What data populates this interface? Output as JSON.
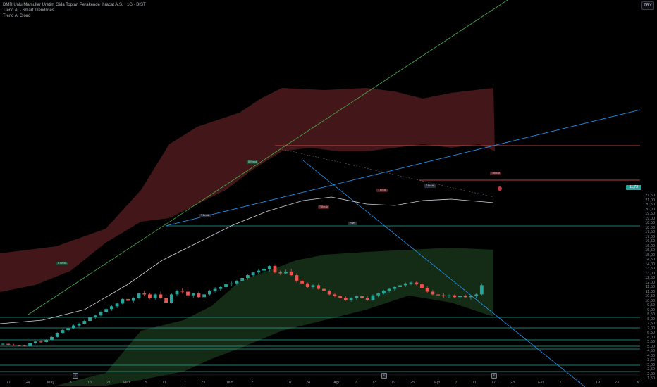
{
  "legend": {
    "symbol_line": "DMR Unlu Mamuller Uretim Gida Toptan Perakende Ihracat A.S. · 1G · BIST",
    "indicator_1": "Trend Ai - Smart Trendlines",
    "indicator_2": "Trend Ai Cloud"
  },
  "currency": "TRY",
  "last_price": "11,73",
  "price_axis": [
    "21,50",
    "21,00",
    "20,50",
    "20,00",
    "19,50",
    "19,00",
    "18,50",
    "18,00",
    "17,50",
    "17,00",
    "16,50",
    "16,00",
    "15,50",
    "15,00",
    "14,50",
    "14,00",
    "13,50",
    "13,00",
    "12,50",
    "12,00",
    "11,50",
    "11,00",
    "10,50",
    "10,00",
    "9,50",
    "9,00",
    "8,50",
    "8,00",
    "7,50",
    "7,00",
    "6,50",
    "6,00",
    "5,50",
    "5,00",
    "4,50",
    "4,00",
    "3,50",
    "3,00",
    "2,50",
    "2,00",
    "1,50"
  ],
  "time_axis": [
    "17",
    "24",
    "May",
    "8",
    "15",
    "21",
    "Haz",
    "5",
    "11",
    "17",
    "23",
    "Tem",
    "12",
    "18",
    "24",
    "Ağu",
    "7",
    "13",
    "19",
    "25",
    "Eyl",
    "7",
    "11",
    "17",
    "23",
    "Eki",
    "7",
    "13",
    "19",
    "23",
    "K"
  ],
  "event_markers": [
    "E",
    "E",
    "F"
  ],
  "annotations": [
    "B Break",
    "B Break",
    "T Break",
    "T Break",
    "T Break",
    "T Break",
    "Pdev",
    "T Break"
  ],
  "colors": {
    "up": "#26a69a",
    "down": "#ef5350",
    "cloud_top": "#4a1a1c",
    "cloud_bottom": "#163018",
    "trend_green": "#4caf50",
    "trend_blue": "#2196f3",
    "level_red": "#ef5350",
    "level_green": "#26a69a",
    "ma": "#d1d4dc"
  },
  "chart_data": {
    "type": "candlestick",
    "ylim": [
      1.5,
      21.5
    ],
    "candles": [
      [
        5.3,
        5.35,
        5.25,
        5.3
      ],
      [
        5.3,
        5.35,
        5.2,
        5.2
      ],
      [
        5.2,
        5.3,
        5.1,
        5.15
      ],
      [
        5.15,
        5.2,
        5.05,
        5.1
      ],
      [
        5.1,
        5.2,
        5.0,
        5.05
      ],
      [
        5.05,
        5.4,
        5.0,
        5.35
      ],
      [
        5.35,
        5.6,
        5.3,
        5.55
      ],
      [
        5.55,
        5.7,
        5.4,
        5.5
      ],
      [
        5.5,
        5.8,
        5.45,
        5.75
      ],
      [
        5.75,
        6.1,
        5.7,
        6.05
      ],
      [
        6.05,
        6.6,
        6.0,
        6.5
      ],
      [
        6.5,
        6.9,
        6.4,
        6.8
      ],
      [
        6.8,
        7.1,
        6.6,
        7.0
      ],
      [
        7.0,
        7.4,
        6.9,
        7.3
      ],
      [
        7.3,
        7.6,
        7.1,
        7.5
      ],
      [
        7.5,
        7.9,
        7.4,
        7.8
      ],
      [
        7.8,
        8.3,
        7.7,
        8.2
      ],
      [
        8.2,
        8.5,
        8.0,
        8.4
      ],
      [
        8.4,
        8.9,
        8.3,
        8.8
      ],
      [
        8.8,
        9.2,
        8.6,
        9.1
      ],
      [
        9.1,
        9.5,
        8.9,
        9.4
      ],
      [
        9.4,
        9.8,
        9.2,
        9.7
      ],
      [
        9.7,
        10.3,
        9.6,
        10.2
      ],
      [
        10.2,
        10.6,
        9.9,
        10.0
      ],
      [
        10.0,
        10.4,
        9.8,
        10.3
      ],
      [
        10.3,
        10.9,
        10.2,
        10.8
      ],
      [
        10.8,
        11.1,
        10.5,
        10.7
      ],
      [
        10.7,
        10.9,
        10.2,
        10.3
      ],
      [
        10.3,
        10.8,
        10.1,
        10.7
      ],
      [
        10.7,
        11.0,
        10.2,
        10.3
      ],
      [
        10.3,
        10.5,
        9.7,
        9.8
      ],
      [
        9.8,
        10.8,
        9.7,
        10.7
      ],
      [
        10.7,
        11.2,
        10.5,
        11.1
      ],
      [
        11.1,
        11.4,
        10.8,
        11.0
      ],
      [
        11.0,
        11.1,
        10.5,
        10.6
      ],
      [
        10.6,
        10.9,
        10.3,
        10.8
      ],
      [
        10.8,
        11.0,
        10.3,
        10.4
      ],
      [
        10.4,
        10.8,
        10.2,
        10.7
      ],
      [
        10.7,
        11.2,
        10.6,
        11.1
      ],
      [
        11.1,
        11.5,
        10.9,
        11.3
      ],
      [
        11.3,
        11.6,
        11.1,
        11.5
      ],
      [
        11.5,
        11.9,
        11.3,
        11.8
      ],
      [
        11.8,
        12.1,
        11.6,
        11.9
      ],
      [
        11.9,
        12.3,
        11.7,
        12.2
      ],
      [
        12.2,
        12.6,
        12.0,
        12.5
      ],
      [
        12.5,
        12.9,
        12.3,
        12.8
      ],
      [
        12.8,
        13.2,
        12.6,
        13.1
      ],
      [
        13.1,
        13.5,
        12.9,
        13.3
      ],
      [
        13.3,
        13.7,
        13.0,
        13.5
      ],
      [
        13.5,
        13.9,
        13.2,
        13.8
      ],
      [
        13.8,
        14.0,
        13.0,
        13.1
      ],
      [
        13.1,
        13.3,
        12.8,
        13.0
      ],
      [
        13.0,
        13.4,
        12.9,
        13.2
      ],
      [
        13.2,
        13.5,
        12.7,
        12.8
      ],
      [
        12.8,
        13.0,
        12.0,
        12.2
      ],
      [
        12.2,
        12.5,
        11.8,
        11.9
      ],
      [
        11.9,
        12.0,
        11.4,
        11.5
      ],
      [
        11.5,
        11.8,
        11.3,
        11.7
      ],
      [
        11.7,
        11.9,
        11.2,
        11.3
      ],
      [
        11.3,
        11.6,
        11.0,
        11.1
      ],
      [
        11.1,
        11.2,
        10.6,
        10.7
      ],
      [
        10.7,
        10.9,
        10.4,
        10.5
      ],
      [
        10.5,
        10.7,
        10.2,
        10.3
      ],
      [
        10.3,
        10.5,
        10.0,
        10.1
      ],
      [
        10.1,
        10.4,
        9.9,
        10.3
      ],
      [
        10.3,
        10.6,
        10.1,
        10.5
      ],
      [
        10.5,
        10.7,
        10.2,
        10.3
      ],
      [
        10.3,
        10.5,
        10.0,
        10.1
      ],
      [
        10.1,
        10.7,
        10.0,
        10.6
      ],
      [
        10.6,
        10.9,
        10.4,
        10.8
      ],
      [
        10.8,
        11.2,
        10.7,
        11.1
      ],
      [
        11.1,
        11.4,
        10.9,
        11.3
      ],
      [
        11.3,
        11.6,
        11.1,
        11.5
      ],
      [
        11.5,
        11.8,
        11.3,
        11.7
      ],
      [
        11.7,
        12.0,
        11.5,
        11.9
      ],
      [
        11.9,
        12.1,
        11.7,
        12.0
      ],
      [
        12.0,
        12.1,
        11.7,
        11.8
      ],
      [
        11.8,
        12.0,
        11.3,
        11.4
      ],
      [
        11.4,
        11.6,
        10.9,
        11.0
      ],
      [
        11.0,
        11.2,
        10.6,
        10.7
      ],
      [
        10.7,
        10.9,
        10.4,
        10.6
      ],
      [
        10.6,
        10.8,
        10.3,
        10.5
      ],
      [
        10.5,
        10.7,
        10.3,
        10.6
      ],
      [
        10.6,
        10.7,
        10.3,
        10.4
      ],
      [
        10.4,
        10.6,
        10.2,
        10.5
      ],
      [
        10.5,
        10.7,
        10.3,
        10.4
      ],
      [
        10.4,
        10.6,
        10.1,
        10.5
      ],
      [
        10.5,
        10.8,
        10.3,
        10.7
      ],
      [
        10.7,
        11.9,
        10.6,
        11.7
      ]
    ]
  }
}
